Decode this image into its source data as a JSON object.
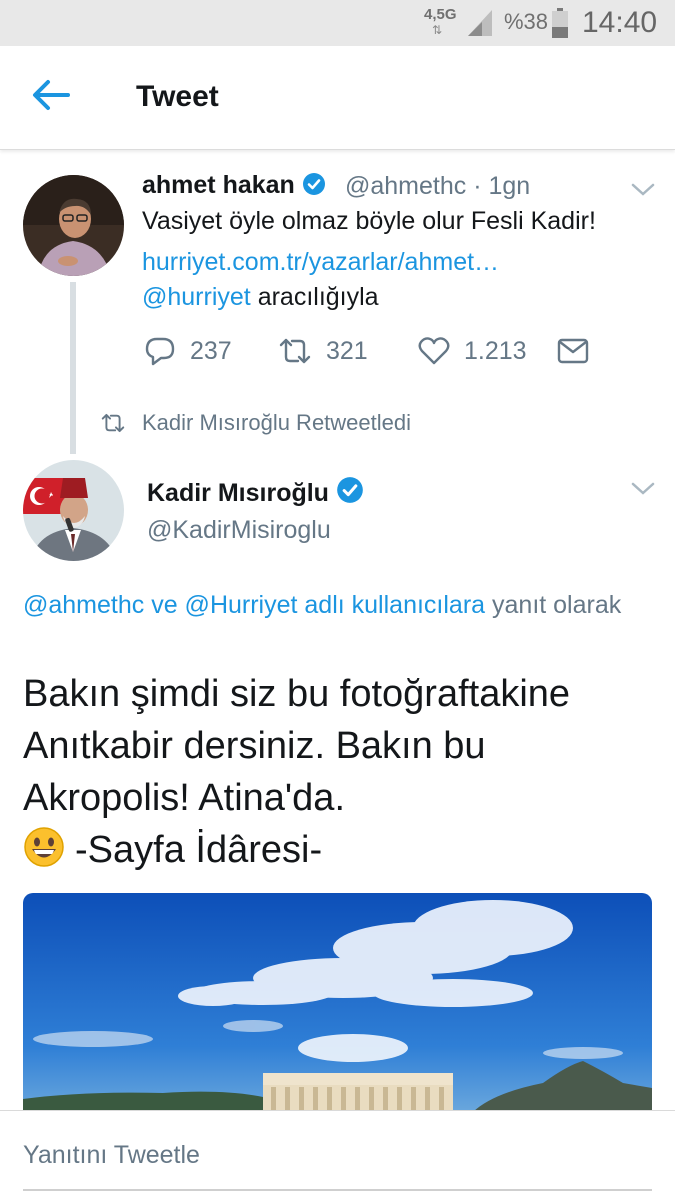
{
  "status_bar": {
    "network": "4,5G",
    "network_arrows": "⇅",
    "battery_text": "%38",
    "clock": "14:40"
  },
  "header": {
    "title": "Tweet",
    "back_icon": "arrow-left-icon"
  },
  "tweet_1": {
    "name": "ahmet hakan",
    "handle": "@ahmethc · 1gn",
    "text": "Vasiyet öyle olmaz böyle olur Fesli Kadir!",
    "link": "hurriyet.com.tr/yazarlar/ahmet…",
    "via_mention": "@hurriyet",
    "via_suffix": " aracılığıyla",
    "replies": "237",
    "retweets": "321",
    "likes": "1.213"
  },
  "retweet_label": "Kadir Mısıroğlu Retweetledi",
  "tweet_2": {
    "name": "Kadir Mısıroğlu",
    "handle": "@KadirMisiroglu",
    "reply_to_mentions": "@ahmethc ve @Hurriyet adlı kullanıcılara",
    "reply_to_suffix": " yanıt olarak",
    "text_lines": [
      "Bakın şimdi siz bu fotoğraftakine",
      "Anıtkabir dersiniz. Bakın bu",
      "Akropolis! Atina'da.",
      "-Sayfa İdâresi-"
    ],
    "emoji": "grinning-face-emoji"
  },
  "reply_bar": {
    "placeholder": "Yanıtını Tweetle"
  },
  "colors": {
    "accent": "#1b95e0",
    "secondary_text": "#657786",
    "primary_text": "#14171a",
    "status_bar_bg": "#e8e8e8"
  }
}
